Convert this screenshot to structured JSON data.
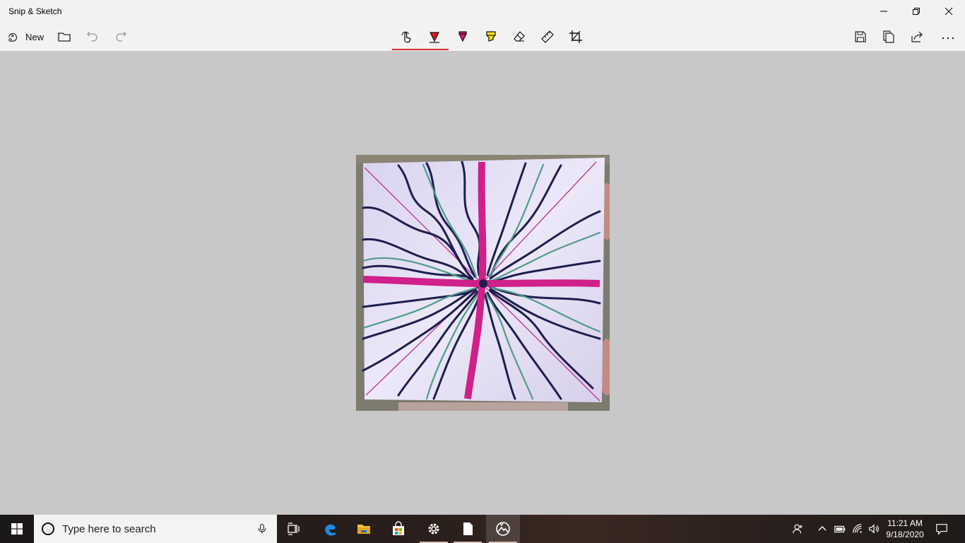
{
  "window": {
    "title": "Snip & Sketch"
  },
  "toolbar": {
    "new_label": "New",
    "tools": [
      {
        "name": "touch-writing",
        "icon": "touch-hand-icon",
        "active": true
      },
      {
        "name": "ballpoint-pen",
        "icon": "ballpoint-pen-icon",
        "color": "#e0141e"
      },
      {
        "name": "pencil",
        "icon": "pencil-icon",
        "color": "#d6157a"
      },
      {
        "name": "highlighter",
        "icon": "highlighter-icon",
        "color": "#f5e400"
      },
      {
        "name": "eraser",
        "icon": "eraser-icon"
      },
      {
        "name": "ruler",
        "icon": "ruler-icon"
      },
      {
        "name": "crop",
        "icon": "crop-icon"
      }
    ],
    "active_color": "#d62a2a"
  },
  "taskbar": {
    "search_placeholder": "Type here to search",
    "pinned": [
      "task-view-icon",
      "edge-icon",
      "file-explorer-icon",
      "store-icon",
      "settings-icon",
      "notepad-icon",
      "snip-sketch-icon"
    ],
    "clock": {
      "time": "11:21 AM",
      "date": "9/18/2020"
    }
  },
  "colors": {
    "canvas_bg": "#c8c8c8",
    "titlebar_bg": "#f2f2f2",
    "ink_magenta": "#d0208a",
    "ink_navy": "#1e1e4e",
    "ink_green": "#4f9c8a"
  }
}
